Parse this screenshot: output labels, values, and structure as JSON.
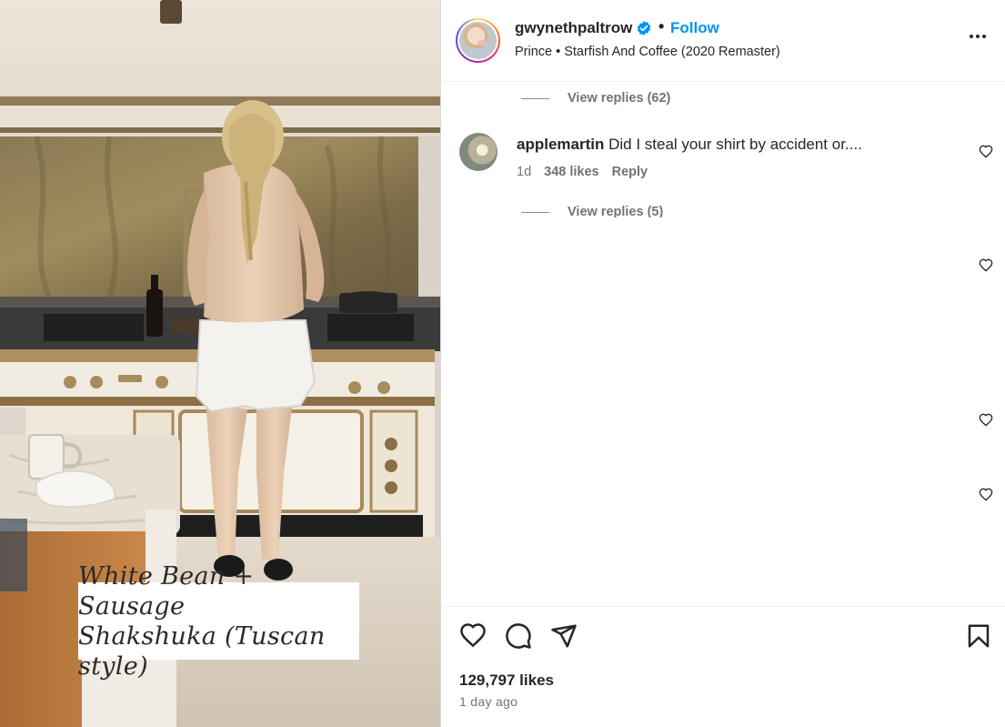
{
  "media": {
    "caption_line1": "White Bean + Sausage",
    "caption_line2": "Shakshuka (Tuscan style)"
  },
  "header": {
    "username": "gwynethpaltrow",
    "verified": true,
    "separator": "•",
    "follow_label": "Follow",
    "music": "Prince • Starfish And Coffee (2020 Remaster)",
    "more_icon": "more-horizontal-icon"
  },
  "comments": {
    "view_replies_1": "View replies (62)",
    "comment": {
      "user": "applemartin",
      "text": "Did I steal your shirt by accident or....",
      "age": "1d",
      "likes": "348 likes",
      "reply_label": "Reply"
    },
    "view_replies_2": "View replies (5)"
  },
  "footer": {
    "likes": "129,797 likes",
    "time": "1 day ago"
  },
  "colors": {
    "accent": "#0095f6",
    "text": "#262626",
    "muted": "#737373"
  }
}
